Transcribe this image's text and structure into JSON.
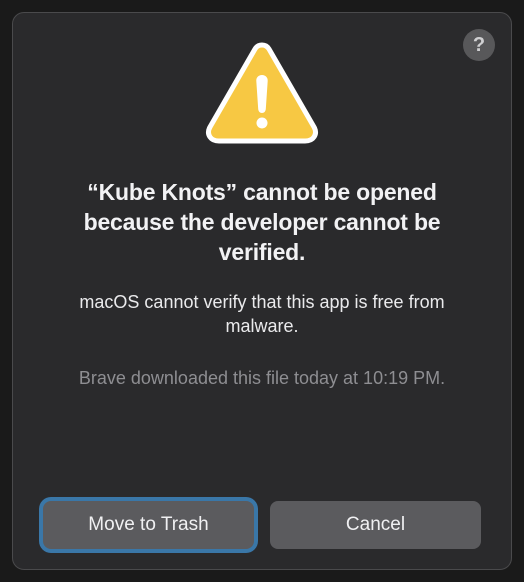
{
  "dialog": {
    "help_label": "?",
    "title": "“Kube Knots” cannot be opened because the developer cannot be verified.",
    "subtitle": "macOS cannot verify that this app is free from malware.",
    "download_info": "Brave downloaded this file today at 10:19 PM.",
    "buttons": {
      "primary": "Move to Trash",
      "secondary": "Cancel"
    }
  }
}
